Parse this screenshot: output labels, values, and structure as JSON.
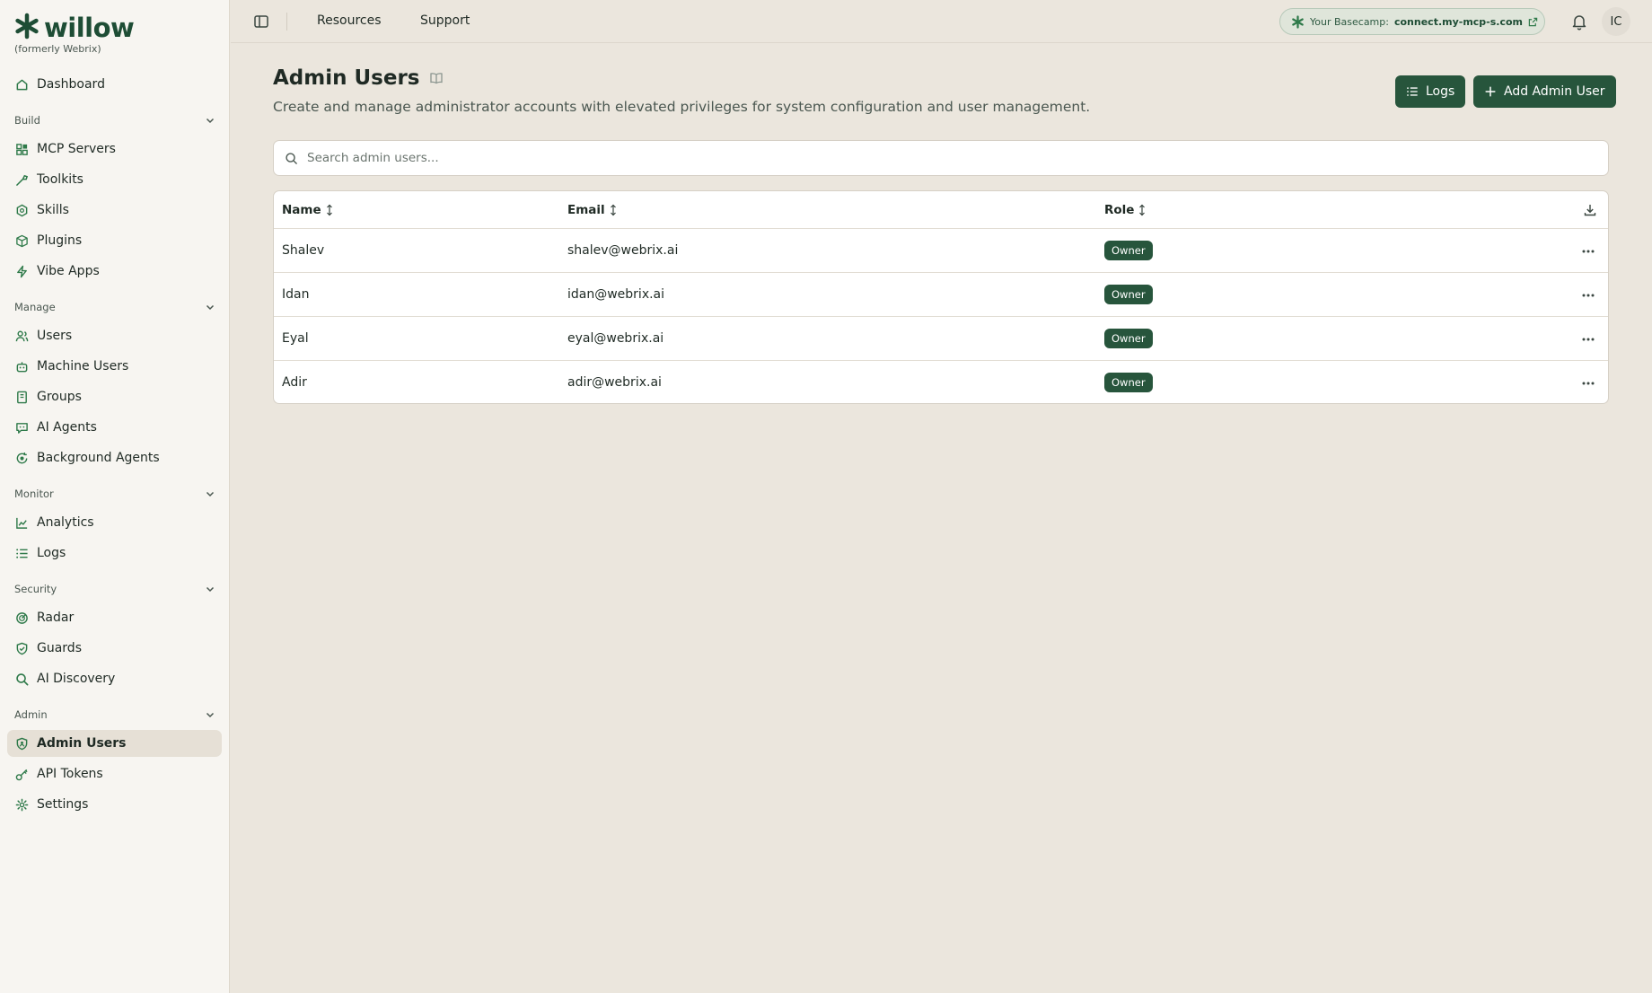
{
  "brand": {
    "name": "willow",
    "subtitle": "(formerly Webrix)"
  },
  "sidebar": {
    "dashboard": "Dashboard",
    "sections": [
      {
        "label": "Build",
        "items": [
          "MCP Servers",
          "Toolkits",
          "Skills",
          "Plugins",
          "Vibe Apps"
        ]
      },
      {
        "label": "Manage",
        "items": [
          "Users",
          "Machine Users",
          "Groups",
          "AI Agents",
          "Background Agents"
        ]
      },
      {
        "label": "Monitor",
        "items": [
          "Analytics",
          "Logs"
        ]
      },
      {
        "label": "Security",
        "items": [
          "Radar",
          "Guards",
          "AI Discovery"
        ]
      },
      {
        "label": "Admin",
        "items": [
          "Admin Users",
          "API Tokens",
          "Settings"
        ]
      }
    ],
    "active": "Admin Users"
  },
  "topbar": {
    "links": [
      "Resources",
      "Support"
    ],
    "basecamp_label": "Your Basecamp:",
    "basecamp_url": "connect.my-mcp-s.com",
    "avatar_initials": "IC"
  },
  "page": {
    "title": "Admin Users",
    "subtitle": "Create and manage administrator accounts with elevated privileges for system configuration and user management.",
    "logs_button": "Logs",
    "add_button": "Add Admin User",
    "search_placeholder": "Search admin users..."
  },
  "table": {
    "columns": [
      "Name",
      "Email",
      "Role"
    ],
    "rows": [
      {
        "name": "Shalev",
        "email": "shalev@webrix.ai",
        "role": "Owner"
      },
      {
        "name": "Idan",
        "email": "idan@webrix.ai",
        "role": "Owner"
      },
      {
        "name": "Eyal",
        "email": "eyal@webrix.ai",
        "role": "Owner"
      },
      {
        "name": "Adir",
        "email": "adir@webrix.ai",
        "role": "Owner"
      }
    ]
  },
  "colors": {
    "accent": "#27553c",
    "background": "#ebe6dd",
    "sidebar": "#f7f5f1"
  },
  "icons": [
    "willow-logo-icon",
    "home-icon",
    "server-icon",
    "toolkit-icon",
    "hexagon-icon",
    "package-icon",
    "bolt-icon",
    "users-icon",
    "robot-icon",
    "book-icon",
    "chat-bot-icon",
    "refresh-bot-icon",
    "chart-icon",
    "list-icon",
    "radar-icon",
    "shield-icon",
    "search-icon",
    "shield-person-icon",
    "key-icon",
    "gear-icon",
    "sidebar-toggle-icon",
    "external-link-icon",
    "bell-icon",
    "book-open-icon",
    "plus-icon",
    "sort-icon",
    "download-icon",
    "more-icon"
  ]
}
